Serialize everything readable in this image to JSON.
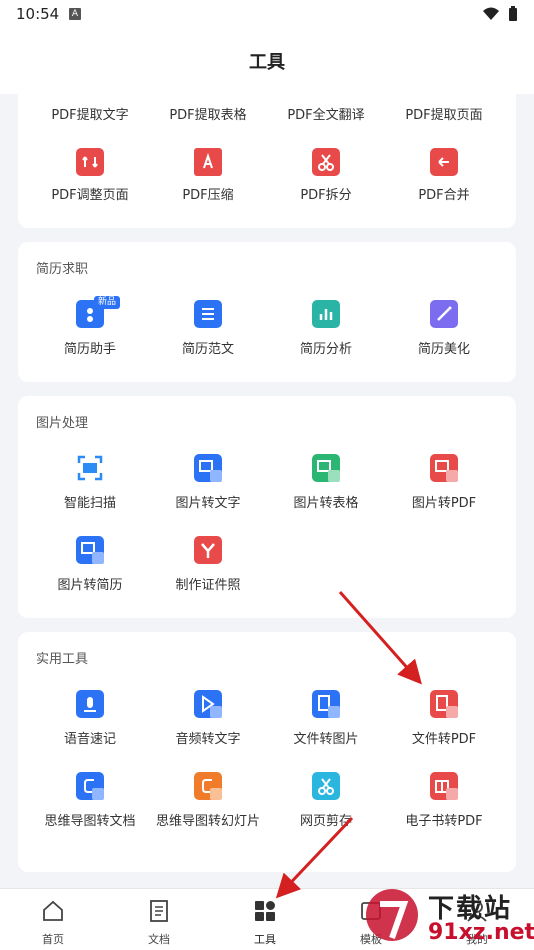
{
  "status_bar": {
    "time": "10:54",
    "notification_letter": "A"
  },
  "header": {
    "title": "工具"
  },
  "pdf_tools": {
    "row1": [
      {
        "label": "PDF提取文字",
        "icon": "pdf-extract-text-icon",
        "color": "#e84a4a"
      },
      {
        "label": "PDF提取表格",
        "icon": "pdf-extract-table-icon",
        "color": "#2bb673"
      },
      {
        "label": "PDF全文翻译",
        "icon": "pdf-translate-icon",
        "color": "#a46cf0"
      },
      {
        "label": "PDF提取页面",
        "icon": "pdf-extract-page-icon",
        "color": "#e84a4a"
      }
    ],
    "row2": [
      {
        "label": "PDF调整页面",
        "icon": "pdf-adjust-page-icon",
        "color": "#e84a4a"
      },
      {
        "label": "PDF压缩",
        "icon": "pdf-compress-icon",
        "color": "#e84a4a"
      },
      {
        "label": "PDF拆分",
        "icon": "pdf-split-icon",
        "color": "#e84a4a"
      },
      {
        "label": "PDF合并",
        "icon": "pdf-merge-icon",
        "color": "#e84a4a"
      }
    ]
  },
  "resume": {
    "title": "简历求职",
    "items": [
      {
        "label": "简历助手",
        "icon": "resume-assistant-icon",
        "color": "#2b72f5",
        "badge": "新品"
      },
      {
        "label": "简历范文",
        "icon": "resume-sample-icon",
        "color": "#2b72f5"
      },
      {
        "label": "简历分析",
        "icon": "resume-analysis-icon",
        "color": "#2ab4a6"
      },
      {
        "label": "简历美化",
        "icon": "resume-beautify-icon",
        "color": "#7b6cf0"
      }
    ]
  },
  "image": {
    "title": "图片处理",
    "items": [
      {
        "label": "智能扫描",
        "icon": "smart-scan-icon",
        "color": "#2b8cf5"
      },
      {
        "label": "图片转文字",
        "icon": "image-to-text-icon",
        "color": "#2b72f5"
      },
      {
        "label": "图片转表格",
        "icon": "image-to-table-icon",
        "color": "#2bb673"
      },
      {
        "label": "图片转PDF",
        "icon": "image-to-pdf-icon",
        "color": "#e84a4a"
      },
      {
        "label": "图片转简历",
        "icon": "image-to-resume-icon",
        "color": "#2b72f5"
      },
      {
        "label": "制作证件照",
        "icon": "id-photo-icon",
        "color": "#e84a4a"
      }
    ]
  },
  "utility": {
    "title": "实用工具",
    "items": [
      {
        "label": "语音速记",
        "icon": "voice-note-icon",
        "color": "#2b72f5"
      },
      {
        "label": "音频转文字",
        "icon": "audio-to-text-icon",
        "color": "#2b72f5"
      },
      {
        "label": "文件转图片",
        "icon": "file-to-image-icon",
        "color": "#2b72f5"
      },
      {
        "label": "文件转PDF",
        "icon": "file-to-pdf-icon",
        "color": "#e84a4a"
      },
      {
        "label": "思维导图转文档",
        "icon": "mindmap-to-doc-icon",
        "color": "#2b72f5"
      },
      {
        "label": "思维导图转幻灯片",
        "icon": "mindmap-to-slides-icon",
        "color": "#f07b2b"
      },
      {
        "label": "网页剪存",
        "icon": "web-clip-icon",
        "color": "#2bb6e0"
      },
      {
        "label": "电子书转PDF",
        "icon": "ebook-to-pdf-icon",
        "color": "#e84a4a"
      }
    ]
  },
  "tabbar": {
    "tabs": [
      {
        "label": "首页",
        "icon": "home-icon"
      },
      {
        "label": "文档",
        "icon": "document-icon"
      },
      {
        "label": "工具",
        "icon": "tools-icon",
        "active": true
      },
      {
        "label": "模板",
        "icon": "template-icon"
      },
      {
        "label": "我的",
        "icon": "profile-icon"
      }
    ]
  },
  "watermark": {
    "line1": "下载站",
    "line2": "91xz.net"
  },
  "colors": {
    "accent_blue": "#2b72f5",
    "pdf_red": "#e84a4a",
    "annotation_arrow": "#d42020"
  }
}
